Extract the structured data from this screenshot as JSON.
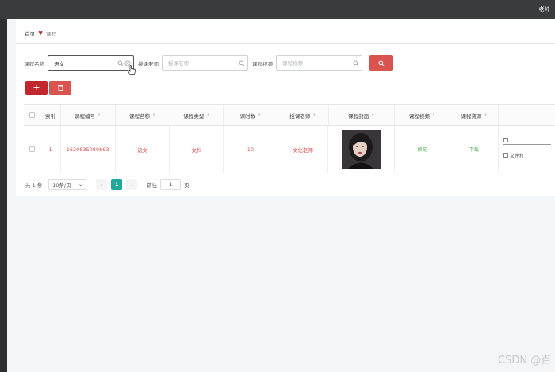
{
  "topbar": {
    "user_label": "老帅 ·"
  },
  "breadcrumb": {
    "home": "首页",
    "current": "课程"
  },
  "search": {
    "fields": [
      {
        "label": "课程名称",
        "value": "语文",
        "placeholder": ""
      },
      {
        "label": "授课老师",
        "value": "",
        "placeholder": "授课老师"
      },
      {
        "label": "课程视频",
        "value": "",
        "placeholder": "课程视频"
      }
    ]
  },
  "toolbar": {
    "add_label": "+"
  },
  "table": {
    "headers": [
      "索引",
      "课程编号",
      "课程名称",
      "课程类型",
      "课时数",
      "授课老师",
      "课程封面",
      "课程视频",
      "课程资源"
    ],
    "row": {
      "index": "1",
      "code": "1620835089663",
      "name": "语文",
      "type": "文科",
      "hours": "10",
      "teacher": "文化老师",
      "video_label": "预览",
      "resource_label": "下载",
      "op1_label": "",
      "op2_label": "文件打"
    }
  },
  "pagination": {
    "total": "共 1 条",
    "page_size": "10条/页",
    "current_page": "1",
    "goto_label": "前往",
    "goto_value": "1",
    "page_suffix": "页"
  },
  "watermark": "CSDN @百",
  "colors": {
    "accent": "#c0282d",
    "danger": "#d9534f",
    "page_active": "#1fa89b",
    "tag": "#4caf50"
  }
}
